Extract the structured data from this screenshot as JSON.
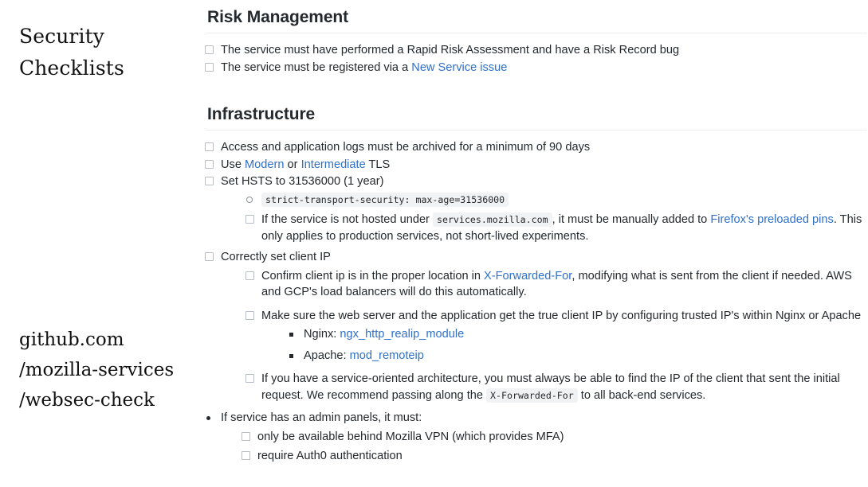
{
  "colors": {
    "link": "#3070c9",
    "text": "#24292e",
    "rule": "#eaecef",
    "code_bg": "#f1f2f3",
    "checkbox_border": "#b9bec4"
  },
  "caption": {
    "title_line1": "Security",
    "title_line2": "Checklists",
    "url_line1": "github.com",
    "url_line2": "/mozilla-services",
    "url_line3": "/websec-check"
  },
  "sections": [
    {
      "heading": "Risk Management",
      "items": [
        {
          "marker": "checkbox",
          "text": "The service must have performed a Rapid Risk Assessment and have a Risk Record bug"
        },
        {
          "marker": "checkbox",
          "text_before": "The service must be registered via a ",
          "link": "New Service issue"
        }
      ]
    },
    {
      "heading": "Infrastructure",
      "items": [
        {
          "marker": "checkbox",
          "text": "Access and application logs must be archived for a minimum of 90 days"
        },
        {
          "marker": "checkbox",
          "text_parts": [
            "Use ",
            "Modern",
            " or ",
            "Intermediate",
            " TLS"
          ],
          "links": [
            "Modern",
            "Intermediate"
          ]
        },
        {
          "marker": "checkbox",
          "text": "Set HSTS to 31536000 (1 year)",
          "children": [
            {
              "marker": "circle",
              "code": "strict-transport-security: max-age=31536000"
            },
            {
              "marker": "checkbox",
              "text_before": "If the service is not hosted under ",
              "code": "services.mozilla.com",
              "text_mid": ", it must be manually added to ",
              "link": "Firefox's preloaded pins",
              "text_after": ". This only applies to production services, not short-lived experiments."
            }
          ]
        },
        {
          "marker": "checkbox",
          "text": "Correctly set client IP",
          "children": [
            {
              "marker": "checkbox",
              "text_before": "Confirm client ip is in the proper location in ",
              "link": "X-Forwarded-For",
              "text_after": ", modifying what is sent from the client if needed. AWS and GCP's load balancers will do this automatically."
            },
            {
              "marker": "checkbox",
              "text": "Make sure the web server and the application get the true client IP by configuring trusted IP's within Nginx or Apache",
              "children": [
                {
                  "marker": "square",
                  "text_before": "Nginx: ",
                  "link": "ngx_http_realip_module"
                },
                {
                  "marker": "square",
                  "text_before": "Apache: ",
                  "link": "mod_remoteip"
                }
              ]
            },
            {
              "marker": "checkbox",
              "text_before": "If you have a service-oriented architecture, you must always be able to find the IP of the client that sent the initial request. We recommend passing along the ",
              "code": "X-Forwarded-For",
              "text_after": " to all back-end services."
            }
          ]
        },
        {
          "marker": "disc",
          "text": "If service has an admin panels, it must:",
          "children": [
            {
              "marker": "checkbox",
              "text": "only be available behind Mozilla VPN (which provides MFA)"
            },
            {
              "marker": "checkbox",
              "text": "require Auth0 authentication"
            }
          ]
        }
      ]
    }
  ]
}
